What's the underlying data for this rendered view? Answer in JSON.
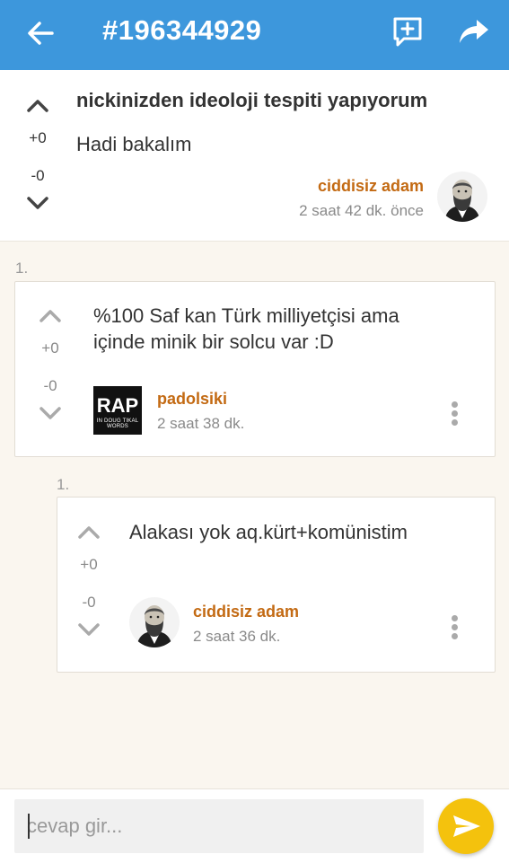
{
  "appbar": {
    "title": "#196344929",
    "icons": [
      "back-arrow-icon",
      "add-comment-icon",
      "share-icon"
    ]
  },
  "topic": {
    "title": "nickinizden ideoloji tespiti yapıyorum",
    "body": "Hadi bakalım",
    "upvotes": "+0",
    "downvotes": "-0",
    "author": "ciddisiz adam",
    "time": "2 saat 42 dk. önce"
  },
  "comments": [
    {
      "index": "1.",
      "text_line1": "%100 Saf kan Türk milliyetçisi ama",
      "text_line2": "içinde minik bir solcu var :D",
      "upvotes": "+0",
      "downvotes": "-0",
      "author": "padolsiki",
      "time": "2 saat 38 dk.",
      "avatar_text": "RAP",
      "avatar_small_text": "IN DOUG TIKAL WORDS"
    },
    {
      "index": "1.",
      "text_line1": "Alakası yok aq.kürt+komünistim",
      "upvotes": "+0",
      "downvotes": "-0",
      "author": "ciddisiz adam",
      "time": "2 saat 36 dk."
    }
  ],
  "reply": {
    "placeholder": "cevap gir..."
  },
  "colors": {
    "appbar": "#3d97dc",
    "author": "#c36a13",
    "send": "#f4c20d",
    "background": "#faf6ef"
  }
}
